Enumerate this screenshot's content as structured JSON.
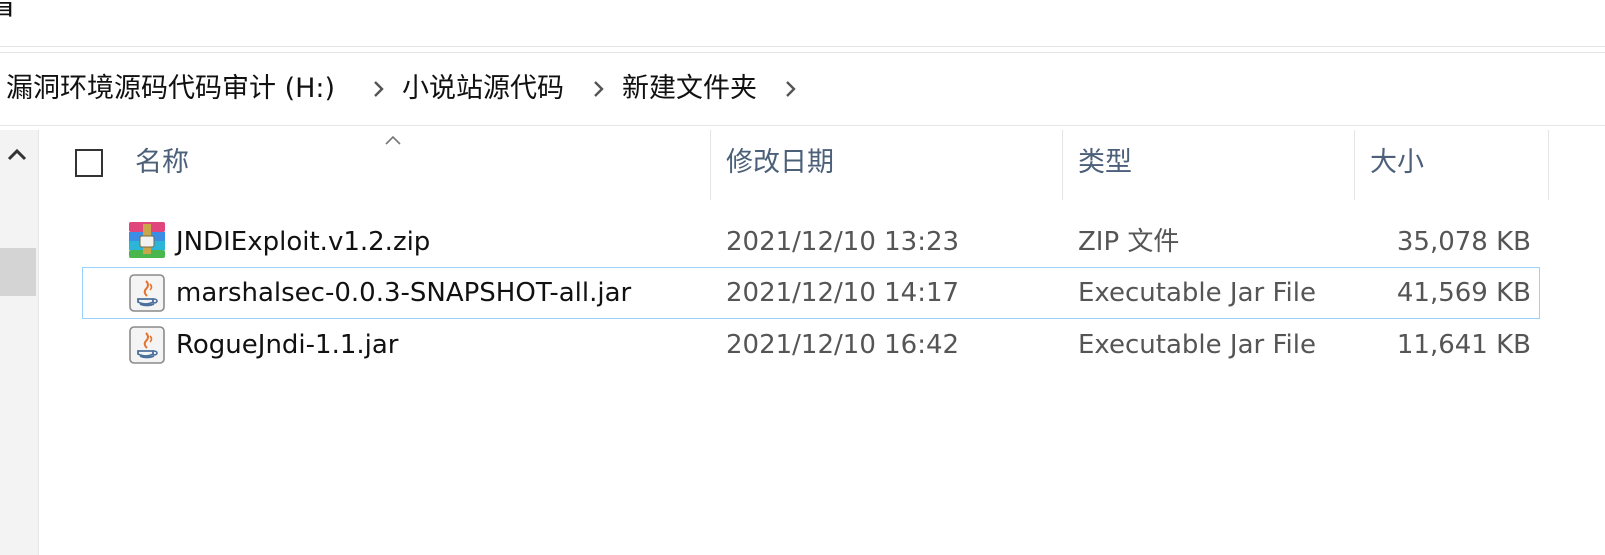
{
  "window": {
    "ribbon_fragment": "看"
  },
  "breadcrumb": {
    "items": [
      {
        "label": "漏洞环境源码代码审计 (H:)"
      },
      {
        "label": "小说站源代码"
      },
      {
        "label": "新建文件夹"
      }
    ]
  },
  "columns": {
    "name": "名称",
    "modified": "修改日期",
    "type": "类型",
    "size": "大小"
  },
  "files": [
    {
      "name": "JNDIExploit.v1.2.zip",
      "modified": "2021/12/10 13:23",
      "type": "ZIP 文件",
      "size": "35,078 KB",
      "icon": "zip-archive-icon"
    },
    {
      "name": "marshalsec-0.0.3-SNAPSHOT-all.jar",
      "modified": "2021/12/10 14:17",
      "type": "Executable Jar File",
      "size": "41,569 KB",
      "icon": "java-jar-icon",
      "focused": true
    },
    {
      "name": "RogueJndi-1.1.jar",
      "modified": "2021/12/10 16:42",
      "type": "Executable Jar File",
      "size": "11,641 KB",
      "icon": "java-jar-icon"
    }
  ],
  "colors": {
    "header_text": "#4c607a",
    "focus_border": "#99d1ff",
    "secondary_text": "#555555"
  }
}
